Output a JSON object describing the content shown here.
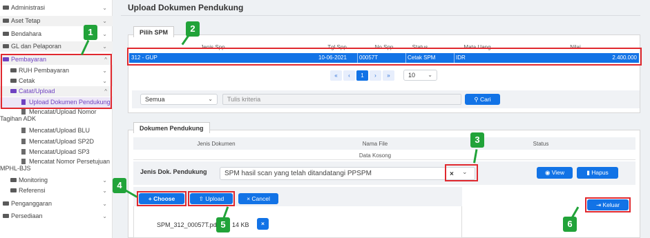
{
  "sidebar": {
    "items": [
      {
        "label": "Administrasi",
        "chev": "⌄"
      },
      {
        "label": "Aset Tetap",
        "chev": "⌄"
      },
      {
        "label": "Bendahara",
        "chev": "⌄"
      },
      {
        "label": "GL dan Pelaporan",
        "chev": "⌄"
      },
      {
        "label": "Pembayaran",
        "chev": "^"
      },
      {
        "label": "RUH Pembayaran",
        "chev": "⌄"
      },
      {
        "label": "Cetak",
        "chev": "⌄"
      },
      {
        "label": "Catat/Upload",
        "chev": "^"
      },
      {
        "label": "Upload Dokumen Pendukung"
      },
      {
        "label": "Mencatat/Upload Nomor",
        "label2": "Tagihan ADK"
      },
      {
        "label": "Mencatat/Upload BLU"
      },
      {
        "label": "Mencatat/Upload SP2D"
      },
      {
        "label": "Mencatat/Upload SP3"
      },
      {
        "label": "Mencatat Nomor Persetujuan",
        "label2": "MPHL-BJS"
      },
      {
        "label": "Monitoring",
        "chev": "⌄"
      },
      {
        "label": "Referensi",
        "chev": "⌄"
      },
      {
        "label": "Penganggaran",
        "chev": "⌄"
      },
      {
        "label": "Persediaan",
        "chev": "⌄"
      }
    ]
  },
  "page": {
    "title": "Upload Dokumen Pendukung"
  },
  "spm": {
    "tab": "Pilih SPM",
    "headers": [
      "Jenis Spp",
      "Tgl Spp",
      "No Spp",
      "Status",
      "Mata Uang",
      "Nilai"
    ],
    "row": {
      "jenis": "312 - GUP",
      "tgl": "10-06-2021",
      "no": "00057T",
      "status": "Cetak SPM",
      "mata_uang": "IDR",
      "nilai": "2.400.000"
    },
    "pager": {
      "first": "«",
      "prev": "‹",
      "current": "1",
      "next": "›",
      "last": "»"
    },
    "page_size": "10",
    "filter": "Semua",
    "search_placeholder": "Tulis kriteria",
    "search_button": "Cari"
  },
  "dokumen": {
    "tab": "Dokumen Pendukung",
    "headers": [
      "Jenis Dokumen",
      "Nama File",
      "Status"
    ],
    "empty": "Data Kosong",
    "jenis_label": "Jenis Dok. Pendukung",
    "jenis_value": "SPM hasil scan yang telah ditandatangi PPSPM",
    "clear": "×",
    "view": "View",
    "hapus": "Hapus"
  },
  "upload": {
    "choose": "Choose",
    "upload": "Upload",
    "cancel": "Cancel",
    "file_name": "SPM_312_00057T.pdf",
    "file_size": "14 KB",
    "remove": "×"
  },
  "keluar": "Keluar",
  "badges": [
    "1",
    "2",
    "3",
    "4",
    "5",
    "6"
  ],
  "colors": {
    "primary": "#1273e6",
    "annotation_red": "#e0282e",
    "annotation_green": "#21a339",
    "active_purple": "#6f42c1"
  }
}
